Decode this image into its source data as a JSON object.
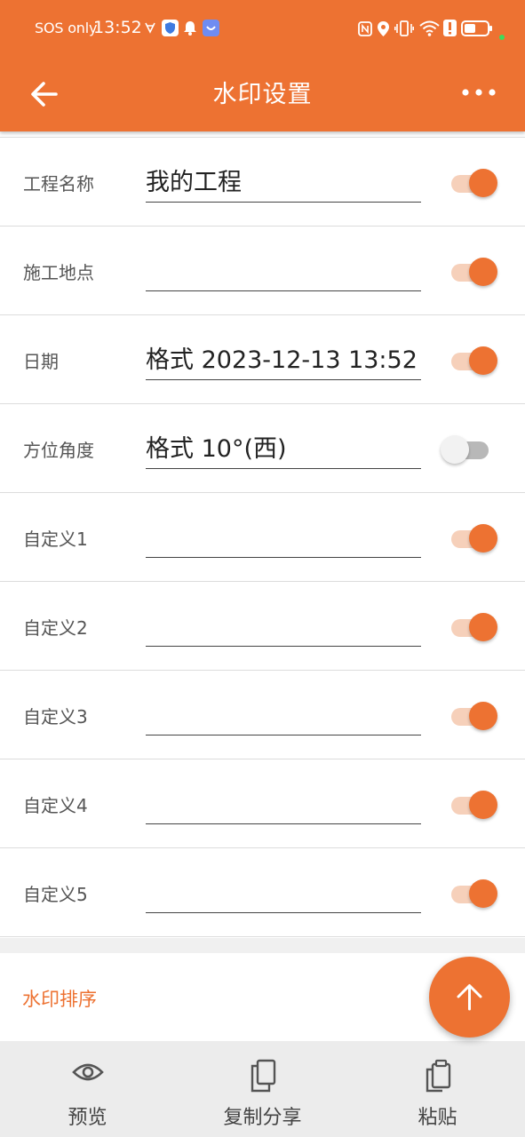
{
  "status_bar": {
    "carrier": "SOS only",
    "time": "13:52"
  },
  "app_bar": {
    "title": "水印设置",
    "back_icon": "arrow-left-icon",
    "more_icon": "more-horizontal-icon"
  },
  "fields": [
    {
      "label": "工程名称",
      "value": "我的工程",
      "enabled": true
    },
    {
      "label": "施工地点",
      "value": "",
      "enabled": true
    },
    {
      "label": "日期",
      "value": "格式 2023-12-13 13:52",
      "enabled": true
    },
    {
      "label": "方位角度",
      "value": "格式 10°(西)",
      "enabled": false
    },
    {
      "label": "自定义1",
      "value": "",
      "enabled": true
    },
    {
      "label": "自定义2",
      "value": "",
      "enabled": true
    },
    {
      "label": "自定义3",
      "value": "",
      "enabled": true
    },
    {
      "label": "自定义4",
      "value": "",
      "enabled": true
    },
    {
      "label": "自定义5",
      "value": "",
      "enabled": true
    }
  ],
  "sort": {
    "label": "水印排序"
  },
  "bottom_nav": [
    {
      "label": "预览",
      "icon": "eye-icon"
    },
    {
      "label": "复制分享",
      "icon": "copy-icon"
    },
    {
      "label": "粘贴",
      "icon": "clipboard-icon"
    }
  ],
  "colors": {
    "accent": "#ED7232",
    "accent_light": "#F6D0BA",
    "bottom_bar": "#ECECEC"
  }
}
